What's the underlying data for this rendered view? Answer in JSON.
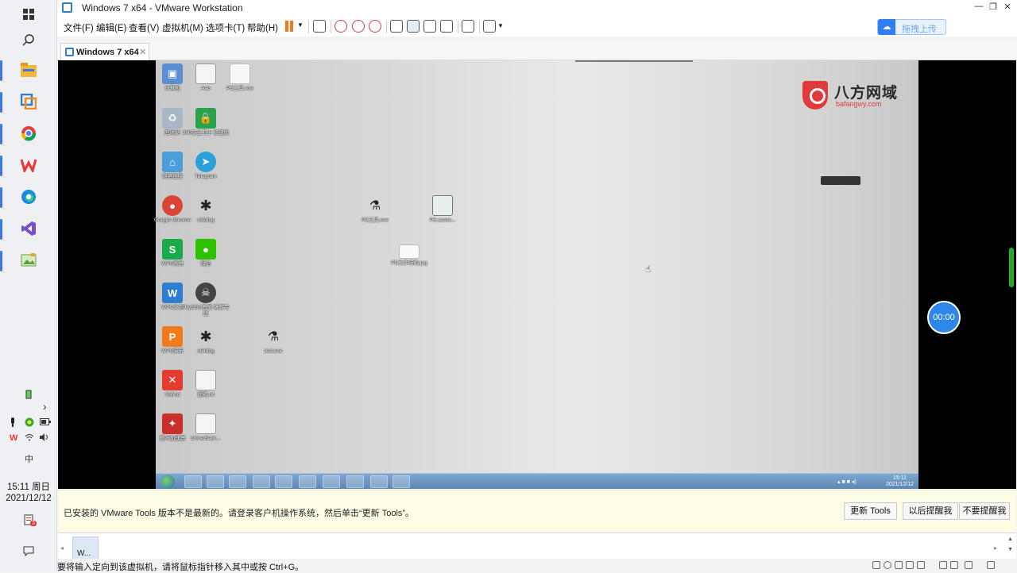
{
  "window": {
    "title": "Windows 7 x64 - VMware Workstation"
  },
  "menu": [
    "文件(F)",
    "编辑(E)",
    "查看(V)",
    "虚拟机(M)",
    "选项卡(T)",
    "帮助(H)"
  ],
  "upload_button": "拖拽上传",
  "tab": {
    "label": "Windows 7 x64",
    "close": "✕"
  },
  "desktop_icons": [
    {
      "label": "计算机"
    },
    {
      "label": "Aab"
    },
    {
      "label": "PE工具.exe"
    },
    {
      "label": "回收站"
    },
    {
      "label": "360安全卫士 极速版"
    },
    {
      "label": "网络连接"
    },
    {
      "label": "Telegram"
    },
    {
      "label": "Google Chrome"
    },
    {
      "label": "x32dbg"
    },
    {
      "label": "WPS表格"
    },
    {
      "label": "微信"
    },
    {
      "label": "WPS文字"
    },
    {
      "label": "OllyDBG吾爱 破解专版"
    },
    {
      "label": "WPS演示"
    },
    {
      "label": "x64dbg"
    },
    {
      "label": "XMind"
    },
    {
      "label": "说明.txt"
    },
    {
      "label": "枫叶加速器"
    },
    {
      "label": "DriverBack..."
    },
    {
      "label": "PE工具.exe"
    },
    {
      "label": "PE.assist..."
    },
    {
      "label": "PE文件结构.jpg"
    },
    {
      "label": "test.exe"
    }
  ],
  "logo": {
    "name": "八方网域",
    "site": "bafangwy.com"
  },
  "guest_clock": {
    "time": "15:11",
    "date": "2021/12/12"
  },
  "timer": "00:00",
  "notice": {
    "message": "已安装的 VMware Tools 版本不是最新的。请登录客户机操作系统，然后单击“更新 Tools”。",
    "buttons": [
      "更新 Tools",
      "以后提醒我",
      "不要提醒我"
    ]
  },
  "thumbnail": {
    "label": "W..."
  },
  "status": {
    "message": "要将输入定向到该虚拟机，请将鼠标指针移入其中或按 Ctrl+G。"
  },
  "host": {
    "clock_time": "15:11 周日",
    "clock_date": "2021/12/12",
    "ime": "中",
    "badge": "3"
  }
}
